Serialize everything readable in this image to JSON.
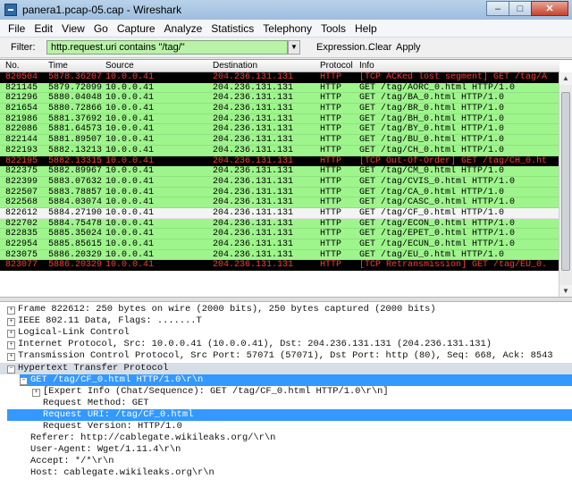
{
  "window": {
    "title": "panera1.pcap-05.cap - Wireshark"
  },
  "titlebar": {
    "minimize": "‒",
    "maximize": "□",
    "close": "✕"
  },
  "menu": [
    "File",
    "Edit",
    "View",
    "Go",
    "Capture",
    "Analyze",
    "Statistics",
    "Telephony",
    "Tools",
    "Help"
  ],
  "filter": {
    "label": "Filter:",
    "value": "http.request.uri contains \"/tag/\"",
    "expression": "Expression...",
    "clear": "Clear",
    "apply": "Apply"
  },
  "columns": {
    "no": "No.",
    "time": "Time",
    "source": "Source",
    "destination": "Destination",
    "protocol": "Protocol",
    "info": "Info"
  },
  "packets": [
    {
      "no": "820504",
      "time": "5878.36207",
      "src": "10.0.0.41",
      "dst": "204.236.131.131",
      "proto": "HTTP",
      "info": "[TCP ACKed lost segment] GET /tag/A",
      "color": "black"
    },
    {
      "no": "821145",
      "time": "5879.72099",
      "src": "10.0.0.41",
      "dst": "204.236.131.131",
      "proto": "HTTP",
      "info": "GET /tag/AORC_0.html HTTP/1.0",
      "color": "green"
    },
    {
      "no": "821296",
      "time": "5880.04048",
      "src": "10.0.0.41",
      "dst": "204.236.131.131",
      "proto": "HTTP",
      "info": "GET /tag/BA_0.html HTTP/1.0",
      "color": "green"
    },
    {
      "no": "821654",
      "time": "5880.72866",
      "src": "10.0.0.41",
      "dst": "204.236.131.131",
      "proto": "HTTP",
      "info": "GET /tag/BR_0.html HTTP/1.0",
      "color": "green"
    },
    {
      "no": "821986",
      "time": "5881.37692",
      "src": "10.0.0.41",
      "dst": "204.236.131.131",
      "proto": "HTTP",
      "info": "GET /tag/BH_0.html HTTP/1.0",
      "color": "green"
    },
    {
      "no": "822086",
      "time": "5881.64573",
      "src": "10.0.0.41",
      "dst": "204.236.131.131",
      "proto": "HTTP",
      "info": "GET /tag/BY_0.html HTTP/1.0",
      "color": "green"
    },
    {
      "no": "822144",
      "time": "5881.89507",
      "src": "10.0.0.41",
      "dst": "204.236.131.131",
      "proto": "HTTP",
      "info": "GET /tag/BU_0.html HTTP/1.0",
      "color": "green"
    },
    {
      "no": "822193",
      "time": "5882.13213",
      "src": "10.0.0.41",
      "dst": "204.236.131.131",
      "proto": "HTTP",
      "info": "GET /tag/CH_0.html HTTP/1.0",
      "color": "green"
    },
    {
      "no": "822195",
      "time": "5882.13315",
      "src": "10.0.0.41",
      "dst": "204.236.131.131",
      "proto": "HTTP",
      "info": "[TCP Out-Of-Order] GET /tag/CH_0.ht",
      "color": "black"
    },
    {
      "no": "822375",
      "time": "5882.89967",
      "src": "10.0.0.41",
      "dst": "204.236.131.131",
      "proto": "HTTP",
      "info": "GET /tag/CM_0.html HTTP/1.0",
      "color": "green"
    },
    {
      "no": "822399",
      "time": "5883.07632",
      "src": "10.0.0.41",
      "dst": "204.236.131.131",
      "proto": "HTTP",
      "info": "GET /tag/CVIS_0.html HTTP/1.0",
      "color": "green"
    },
    {
      "no": "822507",
      "time": "5883.78857",
      "src": "10.0.0.41",
      "dst": "204.236.131.131",
      "proto": "HTTP",
      "info": "GET /tag/CA_0.html HTTP/1.0",
      "color": "green"
    },
    {
      "no": "822568",
      "time": "5884.03074",
      "src": "10.0.0.41",
      "dst": "204.236.131.131",
      "proto": "HTTP",
      "info": "GET /tag/CASC_0.html HTTP/1.0",
      "color": "green"
    },
    {
      "no": "822612",
      "time": "5884.27190",
      "src": "10.0.0.41",
      "dst": "204.236.131.131",
      "proto": "HTTP",
      "info": "GET /tag/CF_0.html HTTP/1.0",
      "color": "white"
    },
    {
      "no": "822702",
      "time": "5884.75478",
      "src": "10.0.0.41",
      "dst": "204.236.131.131",
      "proto": "HTTP",
      "info": "GET /tag/ECON_0.html HTTP/1.0",
      "color": "green"
    },
    {
      "no": "822835",
      "time": "5885.35024",
      "src": "10.0.0.41",
      "dst": "204.236.131.131",
      "proto": "HTTP",
      "info": "GET /tag/EPET_0.html HTTP/1.0",
      "color": "green"
    },
    {
      "no": "822954",
      "time": "5885.85615",
      "src": "10.0.0.41",
      "dst": "204.236.131.131",
      "proto": "HTTP",
      "info": "GET /tag/ECUN_0.html HTTP/1.0",
      "color": "green"
    },
    {
      "no": "823075",
      "time": "5886.20329",
      "src": "10.0.0.41",
      "dst": "204.236.131.131",
      "proto": "HTTP",
      "info": "GET /tag/EU_0.html HTTP/1.0",
      "color": "green"
    },
    {
      "no": "823077",
      "time": "5886.20329",
      "src": "10.0.0.41",
      "dst": "204.236.131.131",
      "proto": "HTTP",
      "info": "[TCP Retransmission] GET /tag/EU_0.",
      "color": "black"
    }
  ],
  "details": [
    {
      "text": "Frame 822612: 250 bytes on wire (2000 bits), 250 bytes captured (2000 bits)",
      "level": 0,
      "expander": "+",
      "hl": ""
    },
    {
      "text": "IEEE 802.11 Data, Flags: .......T",
      "level": 0,
      "expander": "+",
      "hl": ""
    },
    {
      "text": "Logical-Link Control",
      "level": 0,
      "expander": "+",
      "hl": ""
    },
    {
      "text": "Internet Protocol, Src: 10.0.0.41 (10.0.0.41), Dst: 204.236.131.131 (204.236.131.131)",
      "level": 0,
      "expander": "+",
      "hl": ""
    },
    {
      "text": "Transmission Control Protocol, Src Port: 57071 (57071), Dst Port: http (80), Seq: 668, Ack: 8543",
      "level": 0,
      "expander": "+",
      "hl": ""
    },
    {
      "text": "Hypertext Transfer Protocol",
      "level": 0,
      "expander": "−",
      "hl": "grey"
    },
    {
      "text": "GET /tag/CF_0.html HTTP/1.0\\r\\n",
      "level": 1,
      "expander": "−",
      "hl": "blue"
    },
    {
      "text": "[Expert Info (Chat/Sequence): GET /tag/CF_0.html HTTP/1.0\\r\\n]",
      "level": 2,
      "expander": "+",
      "hl": ""
    },
    {
      "text": "Request Method: GET",
      "level": 3,
      "expander": "",
      "hl": ""
    },
    {
      "text": "Request URI: /tag/CF_0.html",
      "level": 3,
      "expander": "",
      "hl": "blue"
    },
    {
      "text": "Request Version: HTTP/1.0",
      "level": 3,
      "expander": "",
      "hl": ""
    },
    {
      "text": "Referer: http://cablegate.wikileaks.org/\\r\\n",
      "level": 1,
      "expander": "",
      "hl": ""
    },
    {
      "text": "User-Agent: Wget/1.11.4\\r\\n",
      "level": 1,
      "expander": "",
      "hl": ""
    },
    {
      "text": "Accept: */*\\r\\n",
      "level": 1,
      "expander": "",
      "hl": ""
    },
    {
      "text": "Host: cablegate.wikileaks.org\\r\\n",
      "level": 1,
      "expander": "",
      "hl": ""
    }
  ],
  "colors": {
    "green": "#9ef58c",
    "black": "#000000",
    "black_text": "#ff3a3a",
    "selected": "#3399ff",
    "filter_bg": "#b9f2a8"
  }
}
